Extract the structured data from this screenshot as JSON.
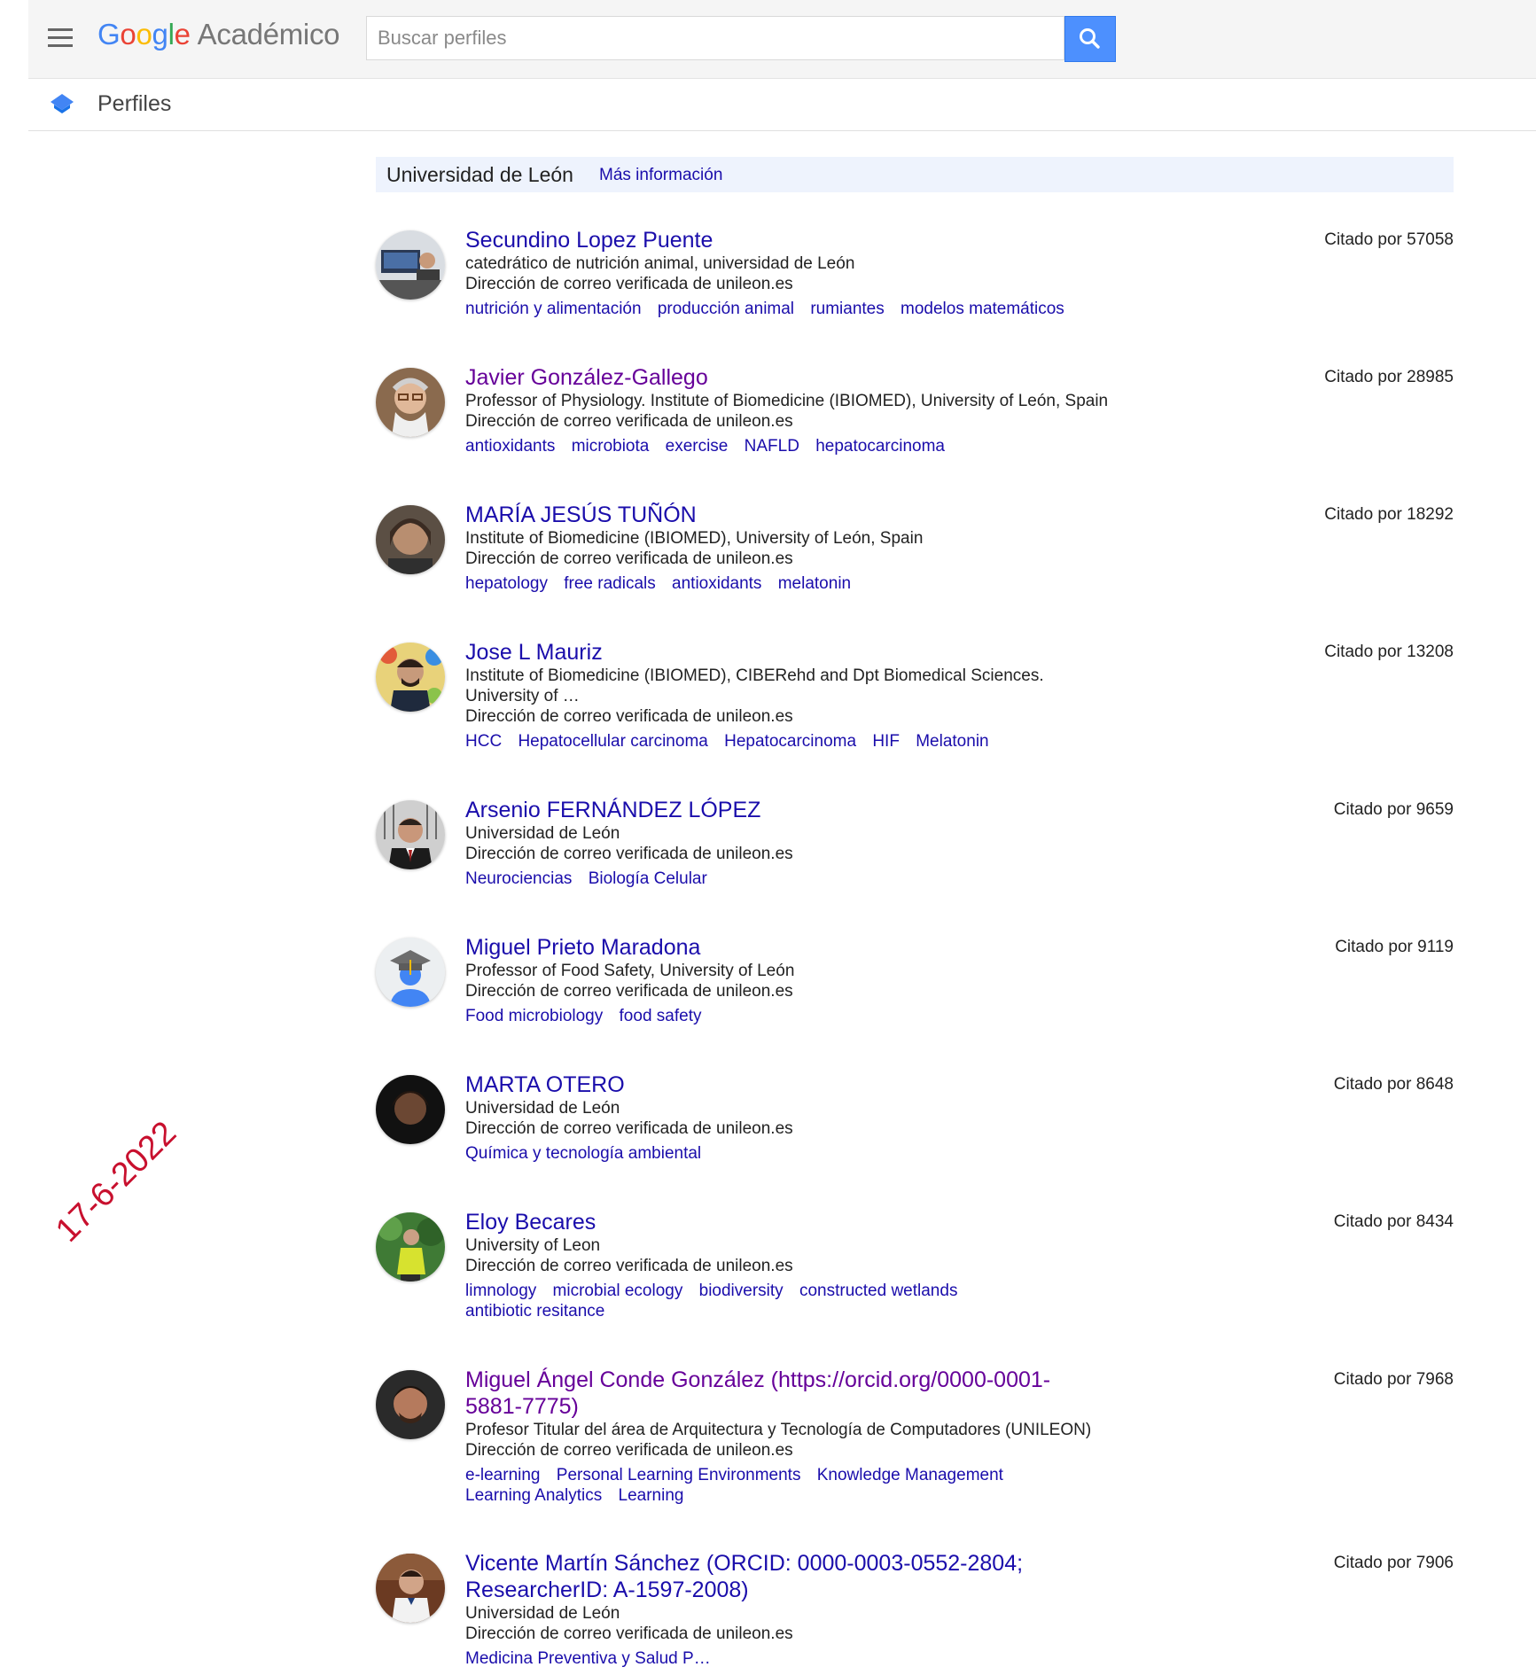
{
  "header": {
    "menu_icon": "hamburger-menu-icon",
    "logo_google": "Google",
    "logo_product": "Académico",
    "search_placeholder": "Buscar perfiles",
    "search_icon": "search-icon",
    "search_button_color": "#4d90fe"
  },
  "subheader": {
    "icon": "profiles-icon",
    "title": "Perfiles"
  },
  "organization": {
    "name": "Universidad de León",
    "more_link": "Más información"
  },
  "profiles": [
    {
      "name": "Secundino Lopez Puente",
      "affiliation": "catedrático de nutrición animal, universidad de León",
      "email": "Dirección de correo verificada de unileon.es",
      "interests": [
        "nutrición y alimentación",
        "producción animal",
        "rumiantes",
        "modelos matemáticos"
      ],
      "cited": "Citado por 57058"
    },
    {
      "name": "Javier González-Gallego",
      "affiliation": "Professor of Physiology. Institute of Biomedicine (IBIOMED), University of León, Spain",
      "email": "Dirección de correo verificada de unileon.es",
      "interests": [
        "antioxidants",
        "microbiota",
        "exercise",
        "NAFLD",
        "hepatocarcinoma"
      ],
      "cited": "Citado por 28985"
    },
    {
      "name": "MARÍA JESÚS TUÑÓN",
      "affiliation": "Institute of Biomedicine (IBIOMED), University of León, Spain",
      "email": "Dirección de correo verificada de unileon.es",
      "interests": [
        "hepatology",
        "free radicals",
        "antioxidants",
        "melatonin"
      ],
      "cited": "Citado por 18292"
    },
    {
      "name": "Jose L Mauriz",
      "affiliation": "Institute of Biomedicine (IBIOMED), CIBERehd and Dpt Biomedical Sciences. University of …",
      "email": "Dirección de correo verificada de unileon.es",
      "interests": [
        "HCC",
        "Hepatocellular carcinoma",
        "Hepatocarcinoma",
        "HIF",
        "Melatonin"
      ],
      "cited": "Citado por 13208"
    },
    {
      "name": "Arsenio FERNÁNDEZ LÓPEZ",
      "affiliation": "Universidad de León",
      "email": "Dirección de correo verificada de unileon.es",
      "interests": [
        "Neurociencias",
        "Biología Celular"
      ],
      "cited": "Citado por 9659"
    },
    {
      "name": "Miguel Prieto Maradona",
      "affiliation": "Professor of Food Safety, University of León",
      "email": "Dirección de correo verificada de unileon.es",
      "interests": [
        "Food microbiology",
        "food safety"
      ],
      "cited": "Citado por 9119"
    },
    {
      "name": "MARTA OTERO",
      "affiliation": "Universidad de León",
      "email": "Dirección de correo verificada de unileon.es",
      "interests": [
        "Química y tecnología ambiental"
      ],
      "cited": "Citado por 8648"
    },
    {
      "name": "Eloy Becares",
      "affiliation": "University of Leon",
      "email": "Dirección de correo verificada de unileon.es",
      "interests": [
        "limnology",
        "microbial ecology",
        "biodiversity",
        "constructed wetlands",
        "antibiotic resitance"
      ],
      "cited": "Citado por 8434"
    },
    {
      "name": "Miguel Ángel Conde González (https://orcid.org/0000-0001-5881-7775)",
      "affiliation": "Profesor Titular del área de Arquitectura y Tecnología de Computadores (UNILEON)",
      "email": "Dirección de correo verificada de unileon.es",
      "interests": [
        "e-learning",
        "Personal Learning Environments",
        "Knowledge Management",
        "Learning Analytics",
        "Learning"
      ],
      "cited": "Citado por 7968"
    },
    {
      "name": "Vicente Martín Sánchez (ORCID: 0000-0003-0552-2804; ResearcherID: A-1597-2008)",
      "affiliation": "Universidad de León",
      "email": "Dirección de correo verificada de unileon.es",
      "interests": [
        "Medicina Preventiva y Salud P…"
      ],
      "cited": "Citado por 7906"
    }
  ],
  "annotation": {
    "date_stamp": "17-6-2022",
    "color": "#c8102e"
  },
  "colors": {
    "link": "#1a0dab",
    "visited_link": "#660099",
    "org_bar_bg": "#eef3fd"
  }
}
